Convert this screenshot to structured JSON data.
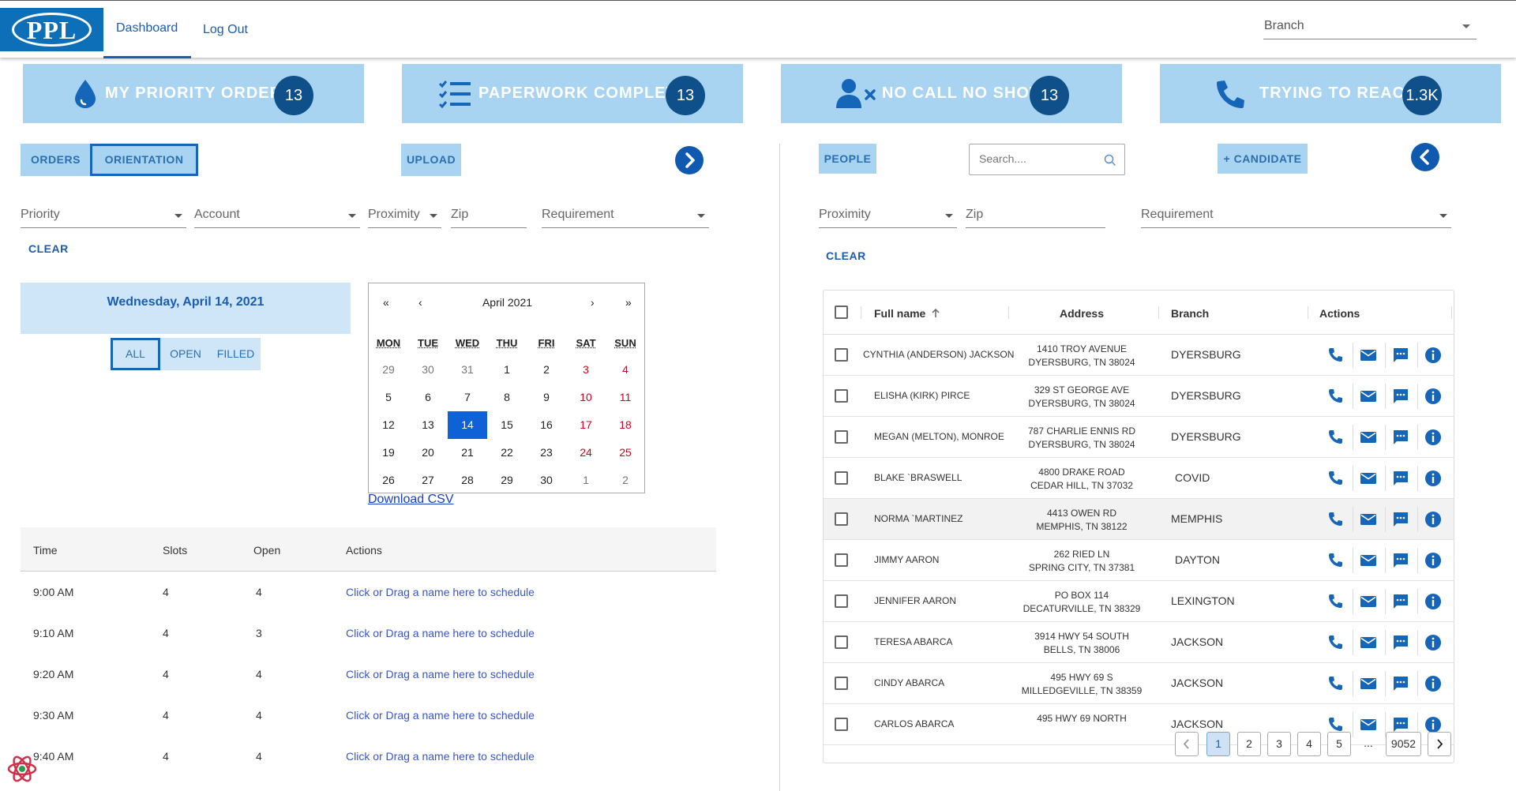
{
  "header": {
    "logo_text": "PPL",
    "nav": [
      {
        "label": "Dashboard"
      },
      {
        "label": "Log Out"
      }
    ],
    "branch_label": "Branch"
  },
  "cards": [
    {
      "title": "MY PRIORITY ORDERS",
      "count": "13",
      "icon": "drop-icon"
    },
    {
      "title": "PAPERWORK COMPLETE",
      "count": "13",
      "icon": "checklist-icon"
    },
    {
      "title": "NO CALL NO SHOW",
      "count": "13",
      "icon": "user-x-icon"
    },
    {
      "title": "TRYING TO REACH",
      "count": "1.3K",
      "icon": "phone-icon"
    }
  ],
  "left": {
    "tabs": [
      {
        "label": "ORDERS"
      },
      {
        "label": "ORIENTATION"
      }
    ],
    "upload_label": "UPLOAD",
    "filters": [
      {
        "label": "Priority"
      },
      {
        "label": "Account"
      },
      {
        "label": "Proximity"
      },
      {
        "label": "Zip"
      },
      {
        "label": "Requirement"
      }
    ],
    "clear_label": "CLEAR",
    "date_text": "Wednesday, April 14, 2021",
    "segments": [
      {
        "label": "ALL"
      },
      {
        "label": "OPEN"
      },
      {
        "label": "FILLED"
      }
    ],
    "calendar": {
      "nav": [
        "«",
        "‹",
        "›",
        "»"
      ],
      "title": "April 2021",
      "dow": [
        "MON",
        "TUE",
        "WED",
        "THU",
        "FRI",
        "SAT",
        "SUN"
      ],
      "weeks": [
        [
          "29",
          "30",
          "31",
          "1",
          "2",
          "3",
          "4"
        ],
        [
          "5",
          "6",
          "7",
          "8",
          "9",
          "10",
          "11"
        ],
        [
          "12",
          "13",
          "14",
          "15",
          "16",
          "17",
          "18"
        ],
        [
          "19",
          "20",
          "21",
          "22",
          "23",
          "24",
          "25"
        ],
        [
          "26",
          "27",
          "28",
          "29",
          "30",
          "1",
          "2"
        ]
      ]
    },
    "download_label": "Download CSV",
    "schedule": {
      "headers": [
        "Time",
        "Slots",
        "Open",
        "Actions"
      ],
      "rows": [
        {
          "time": "9:00 AM",
          "slots": "4",
          "open": "4",
          "action": "Click or Drag a name here to schedule"
        },
        {
          "time": "9:10 AM",
          "slots": "4",
          "open": "3",
          "action": "Click or Drag a name here to schedule"
        },
        {
          "time": "9:20 AM",
          "slots": "4",
          "open": "4",
          "action": "Click or Drag a name here to schedule"
        },
        {
          "time": "9:30 AM",
          "slots": "4",
          "open": "4",
          "action": "Click or Drag a name here to schedule"
        },
        {
          "time": "9:40 AM",
          "slots": "4",
          "open": "4",
          "action": "Click or Drag a name here to schedule"
        }
      ]
    }
  },
  "right": {
    "people_label": "PEOPLE",
    "search_placeholder": "Search....",
    "candidate_label": "+ CANDIDATE",
    "filters": [
      {
        "label": "Proximity"
      },
      {
        "label": "Zip"
      },
      {
        "label": "Requirement"
      }
    ],
    "clear_label": "CLEAR",
    "table": {
      "headers": [
        "Full name",
        "Address",
        "Branch",
        "Actions"
      ],
      "rows": [
        {
          "name": "CYNTHIA (ANDERSON) JACKSON",
          "addr1": "1410 TROY AVENUE",
          "addr2": "DYERSBURG, TN 38024",
          "branch": "DYERSBURG"
        },
        {
          "name": "ELISHA (KIRK) PIRCE",
          "addr1": "329 ST GEORGE AVE",
          "addr2": "DYERSBURG, TN 38024",
          "branch": "DYERSBURG"
        },
        {
          "name": "MEGAN (MELTON), MONROE",
          "addr1": "787 CHARLIE ENNIS RD",
          "addr2": "DYERSBURG, TN 38024",
          "branch": "DYERSBURG"
        },
        {
          "name": "BLAKE `BRASWELL",
          "addr1": "4800 DRAKE ROAD",
          "addr2": "CEDAR HILL, TN 37032",
          "branch": "COVID"
        },
        {
          "name": "NORMA `MARTINEZ",
          "addr1": "4413 OWEN RD",
          "addr2": "MEMPHIS, TN 38122",
          "branch": "MEMPHIS"
        },
        {
          "name": "JIMMY AARON",
          "addr1": "262 RIED LN",
          "addr2": "SPRING CITY, TN 37381",
          "branch": "DAYTON"
        },
        {
          "name": "JENNIFER AARON",
          "addr1": "PO BOX 114",
          "addr2": "DECATURVILLE, TN 38329",
          "branch": "LEXINGTON"
        },
        {
          "name": "TERESA ABARCA",
          "addr1": "3914 HWY 54 SOUTH",
          "addr2": "BELLS, TN 38006",
          "branch": "JACKSON"
        },
        {
          "name": "CINDY ABARCA",
          "addr1": "495 HWY 69 S",
          "addr2": "MILLEDGEVILLE, TN 38359",
          "branch": "JACKSON"
        },
        {
          "name": "CARLOS ABARCA",
          "addr1": "495 HWY 69 NORTH",
          "addr2": "",
          "branch": "JACKSON"
        }
      ],
      "pager": [
        "1",
        "2",
        "3",
        "4",
        "5",
        "...",
        "9052"
      ]
    }
  },
  "colors": {
    "card_bg": "#a8d4f2",
    "badge": "#0f4f8a",
    "accent": "#1565b8",
    "weekend": "#d0021b",
    "selected_day": "#0f62d6"
  }
}
